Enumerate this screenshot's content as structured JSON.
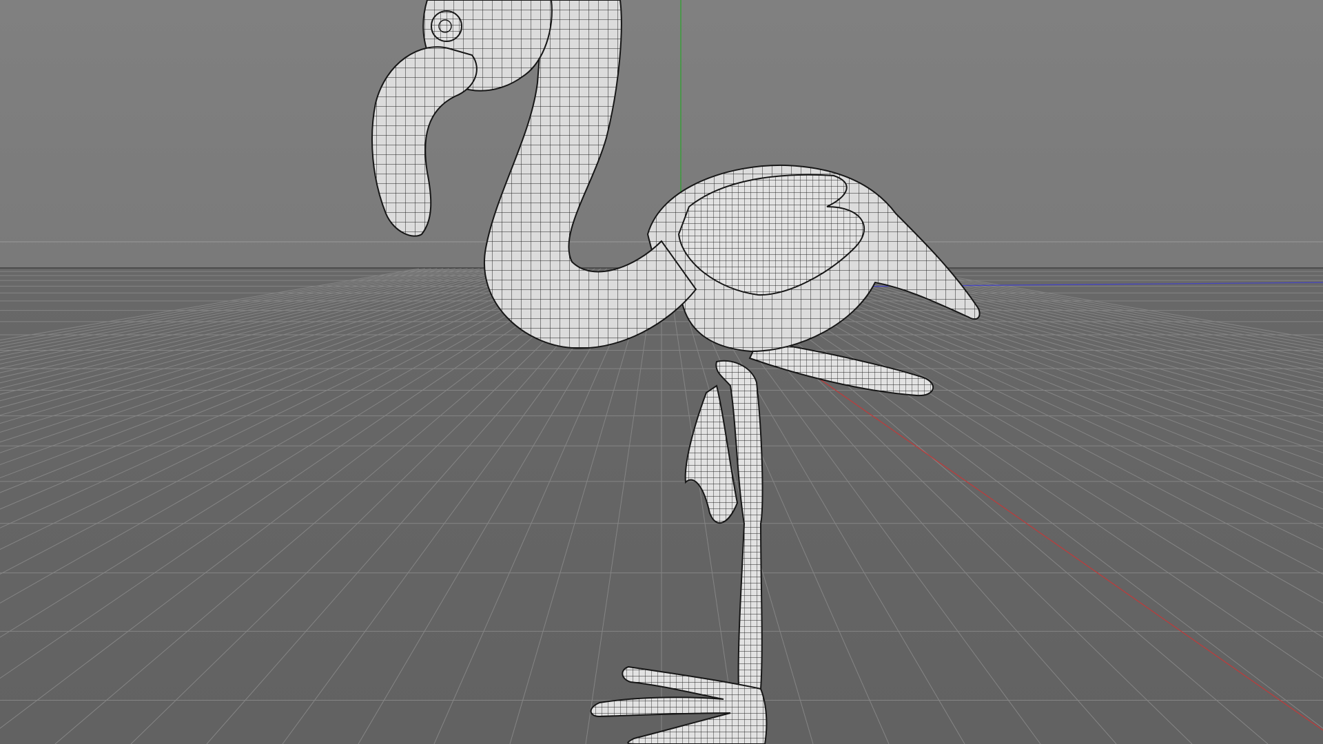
{
  "viewport": {
    "view": "perspective",
    "background_color": "#7e7e7e",
    "floor_color": "#6b6b6b",
    "grid_line_color": "#8a8a8a",
    "axis_colors": {
      "x": "#c23a3a",
      "y": "#2aa52a",
      "z": "#3a3ac2"
    },
    "mesh": {
      "name": "flamingo",
      "display": "wireframe-on-shaded",
      "fill_color": "#d9d9d9",
      "wire_color": "#1a1a1a"
    },
    "grid": {
      "visible": true
    }
  }
}
